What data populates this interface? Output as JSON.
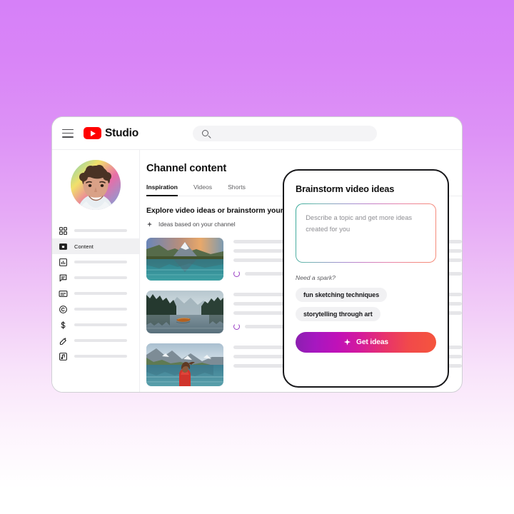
{
  "background": {
    "top_color": "#d680f8",
    "bottom_color": "#ffffff"
  },
  "browser": {
    "header": {
      "menu_icon": "hamburger-icon",
      "brand_name": "Studio",
      "logo_icon": "youtube-logo-icon",
      "search": {
        "icon": "search-icon",
        "value": "",
        "placeholder": ""
      }
    },
    "sidebar": {
      "avatar": "channel-avatar",
      "items": [
        {
          "icon": "dashboard-icon",
          "label": "",
          "active": false
        },
        {
          "icon": "content-icon",
          "label": "Content",
          "active": true
        },
        {
          "icon": "analytics-icon",
          "label": "",
          "active": false
        },
        {
          "icon": "comments-icon",
          "label": "",
          "active": false
        },
        {
          "icon": "subtitles-icon",
          "label": "",
          "active": false
        },
        {
          "icon": "copyright-icon",
          "label": "",
          "active": false
        },
        {
          "icon": "earn-icon",
          "label": "",
          "active": false
        },
        {
          "icon": "customization-icon",
          "label": "",
          "active": false
        },
        {
          "icon": "audio-library-icon",
          "label": "",
          "active": false
        }
      ]
    },
    "main": {
      "page_title": "Channel content",
      "tabs": [
        {
          "label": "Inspiration",
          "active": true
        },
        {
          "label": "Videos",
          "active": false
        },
        {
          "label": "Shorts",
          "active": false
        }
      ],
      "explore_heading": "Explore video ideas or brainstorm your own",
      "ideas_row": {
        "icon": "sparkle-icon",
        "label": "Ideas based on your channel"
      },
      "cards": [
        {
          "thumbnail": "matterhorn-lake-reflection-thumbnail"
        },
        {
          "thumbnail": "canoe-misty-lake-forest-thumbnail"
        },
        {
          "thumbnail": "woman-red-jacket-mountain-lake-thumbnail"
        }
      ]
    }
  },
  "dialog": {
    "title": "Brainstorm video ideas",
    "textarea": {
      "value": "",
      "placeholder": "Describe a topic and get more ideas created for you"
    },
    "spark_label": "Need a spark?",
    "chips": [
      "fun sketching techniques",
      "storytelling through art"
    ],
    "cta": {
      "icon": "sparkle-icon",
      "label": "Get ideas"
    }
  }
}
